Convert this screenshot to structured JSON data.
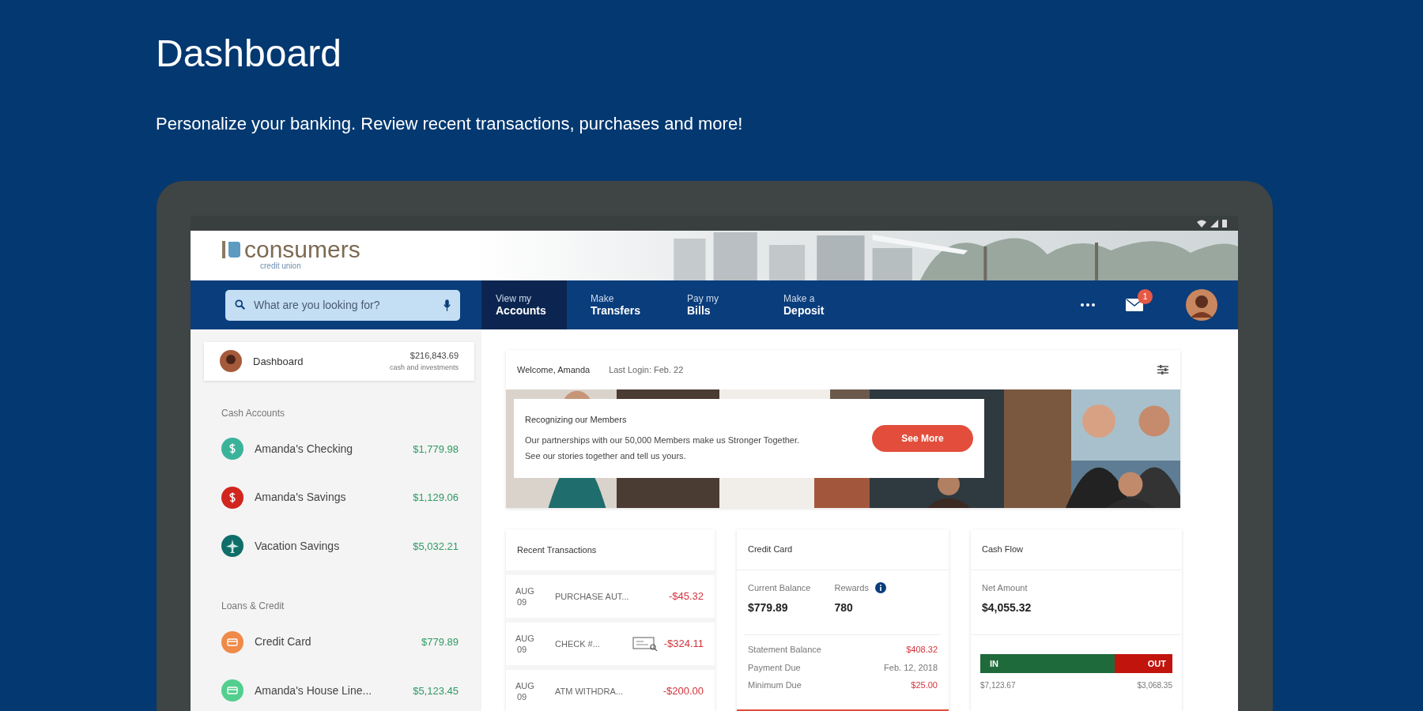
{
  "page": {
    "title": "Dashboard",
    "subtitle": "Personalize your banking. Review recent transactions, purchases and more!"
  },
  "logo": {
    "name": "consumers",
    "tagline": "credit union"
  },
  "search": {
    "placeholder": "What are you looking for?"
  },
  "nav_tabs": [
    {
      "line1": "View my",
      "line2": "Accounts",
      "selected": true
    },
    {
      "line1": "Make",
      "line2": "Transfers",
      "selected": false
    },
    {
      "line1": "Pay my",
      "line2": "Bills",
      "selected": false
    },
    {
      "line1": "Make a",
      "line2": "Deposit",
      "selected": false
    }
  ],
  "mail_badge": "1",
  "sidebar": {
    "dashboard": {
      "label": "Dashboard",
      "amount": "$216,843.69",
      "caption": "cash and investments"
    },
    "sections": [
      {
        "heading": "Cash Accounts",
        "accounts": [
          {
            "name": "Amanda's Checking",
            "amount": "$1,779.98",
            "kind": "dollar",
            "color": "#3bb39a"
          },
          {
            "name": "Amanda's Savings",
            "amount": "$1,129.06",
            "kind": "dollar",
            "color": "#d0261e"
          },
          {
            "name": "Vacation Savings",
            "amount": "$5,032.21",
            "kind": "plane",
            "color": "#106e6a"
          }
        ]
      },
      {
        "heading": "Loans & Credit",
        "accounts": [
          {
            "name": "Credit Card",
            "amount": "$779.89",
            "kind": "card",
            "color": "#ef8a48"
          },
          {
            "name": "Amanda's House Line...",
            "amount": "$5,123.45",
            "kind": "card",
            "color": "#52cf8e"
          }
        ]
      }
    ]
  },
  "welcome": {
    "greeting": "Welcome, Amanda",
    "last_login": "Last Login: Feb. 22"
  },
  "promo": {
    "title": "Recognizing our Members",
    "text": "Our partnerships with our 50,000 Members make us Stronger Together. See our stories together and tell us yours.",
    "button": "See More"
  },
  "transactions": {
    "title": "Recent Transactions",
    "rows": [
      {
        "month": "AUG",
        "day": "09",
        "description": "PURCHASE AUT...",
        "amount": "-$45.32",
        "check_image": false
      },
      {
        "month": "AUG",
        "day": "09",
        "description": "CHECK #...",
        "amount": "-$324.11",
        "check_image": true
      },
      {
        "month": "AUG",
        "day": "09",
        "description": "ATM WITHDRA...",
        "amount": "-$200.00",
        "check_image": false
      }
    ]
  },
  "credit_card": {
    "title": "Credit Card",
    "balance_label": "Current Balance",
    "balance": "$779.89",
    "rewards_label": "Rewards",
    "rewards": "780",
    "details": [
      {
        "label": "Statement Balance",
        "value": "$408.32",
        "kind": "amount"
      },
      {
        "label": "Payment Due",
        "value": "Feb. 12, 2018",
        "kind": "date"
      },
      {
        "label": "Minimum Due",
        "value": "$25.00",
        "kind": "amount"
      }
    ]
  },
  "cash_flow": {
    "title": "Cash Flow",
    "net_label": "Net Amount",
    "net": "$4,055.32",
    "in_label": "IN",
    "out_label": "OUT",
    "level": 0.7,
    "in_amount": "$7,123.67",
    "out_amount": "$3,068.35"
  }
}
